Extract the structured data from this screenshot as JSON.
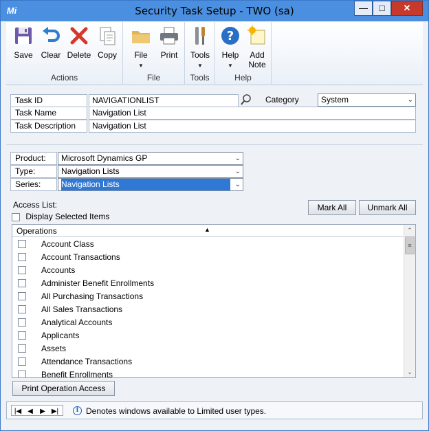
{
  "window": {
    "title": "Security Task Setup  -  TWO (sa)",
    "app_icon": "Mi"
  },
  "ribbon": {
    "groups": [
      {
        "label": "Actions",
        "buttons": [
          {
            "label": "Save",
            "icon": "floppy-icon"
          },
          {
            "label": "Clear",
            "icon": "undo-icon"
          },
          {
            "label": "Delete",
            "icon": "x-icon"
          },
          {
            "label": "Copy",
            "icon": "copy-icon"
          }
        ]
      },
      {
        "label": "File",
        "buttons": [
          {
            "label": "File",
            "icon": "folder-icon"
          },
          {
            "label": "Print",
            "icon": "printer-icon"
          }
        ]
      },
      {
        "label": "Tools",
        "buttons": [
          {
            "label": "Tools",
            "icon": "tools-icon"
          }
        ]
      },
      {
        "label": "Help",
        "buttons": [
          {
            "label": "Help",
            "icon": "help-icon"
          },
          {
            "label": "Add",
            "label2": "Note",
            "icon": "note-icon"
          }
        ]
      }
    ]
  },
  "task": {
    "id_label": "Task ID",
    "id_value": "NAVIGATIONLIST",
    "category_label": "Category",
    "category_value": "System",
    "name_label": "Task Name",
    "name_value": "Navigation List",
    "desc_label": "Task Description",
    "desc_value": "Navigation List"
  },
  "filters": {
    "product_label": "Product:",
    "product_value": "Microsoft Dynamics GP",
    "type_label": "Type:",
    "type_value": "Navigation Lists",
    "series_label": "Series:",
    "series_value": "Navigation Lists"
  },
  "access": {
    "label": "Access List:",
    "display_selected_label": "Display Selected Items",
    "mark_all": "Mark All",
    "unmark_all": "Unmark All",
    "column_header": "Operations",
    "items": [
      "Account Class",
      "Account Transactions",
      "Accounts",
      "Administer Benefit Enrollments",
      "All Purchasing Transactions",
      "All Sales Transactions",
      "Analytical Accounts",
      "Applicants",
      "Assets",
      "Attendance Transactions",
      "Benefit Enrollments"
    ]
  },
  "print_button": "Print Operation Access",
  "status": {
    "nav_first": "|◀",
    "nav_prev": "◀",
    "nav_next": "▶",
    "nav_last": "▶|",
    "info_text": "Denotes windows available to Limited user types."
  }
}
